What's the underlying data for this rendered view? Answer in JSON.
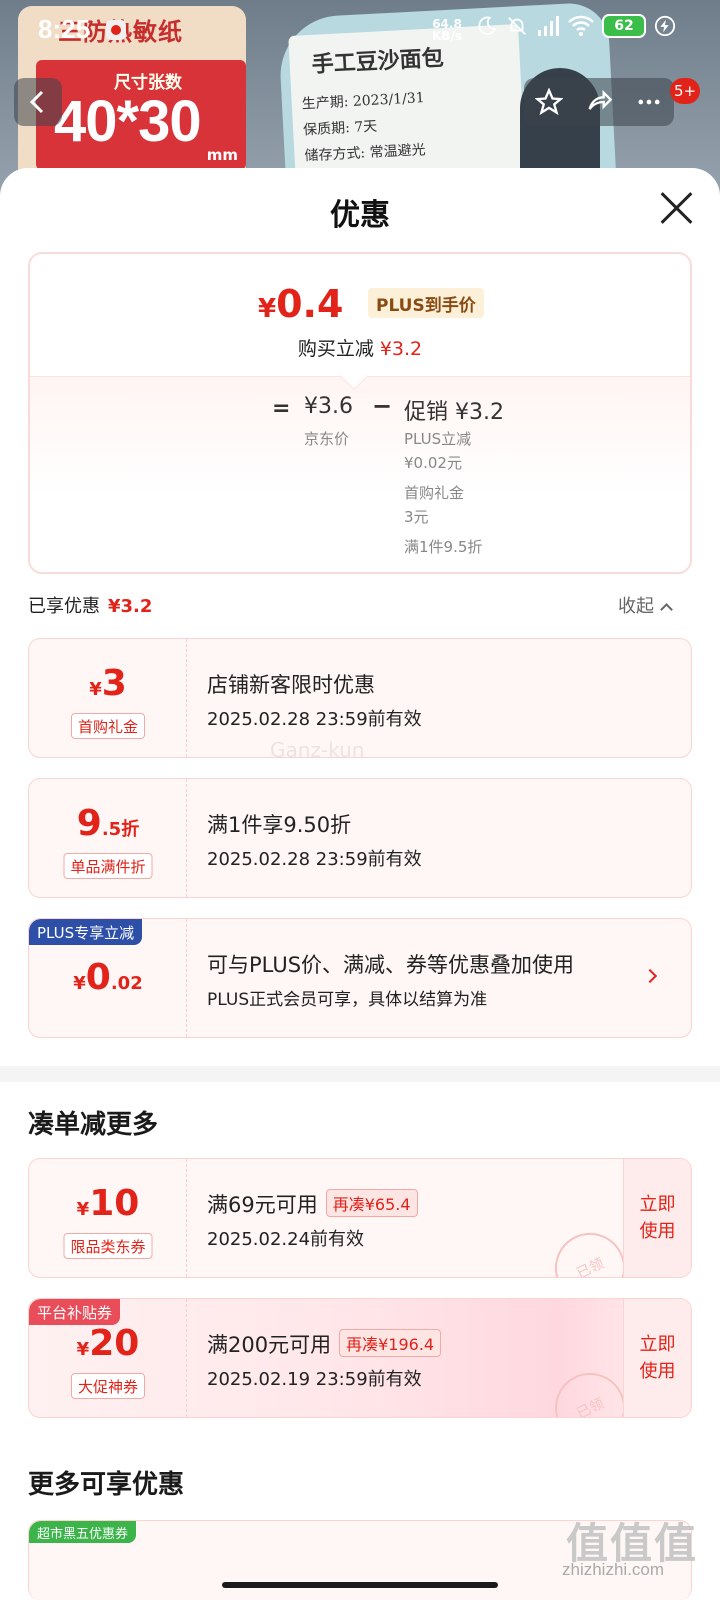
{
  "background": {
    "label_top_text": "三防热敏纸",
    "size_label": "尺寸张数",
    "size_value": "40*30",
    "size_unit": "mm",
    "roll_title": "手工豆沙面包",
    "roll_rows": [
      "生产期:  2023/1/31",
      "保质期:  7天",
      "储存方式:  常温避光"
    ],
    "badge": "5+"
  },
  "status_bar": {
    "time": "8:25",
    "net_speed": "64.8",
    "net_unit": "KB/s",
    "battery": "62"
  },
  "sheet": {
    "title": "优惠",
    "price_card": {
      "currency": "¥",
      "final_price": "0.4",
      "plus_tag": "PLUS到手价",
      "buy_reduce_label": "购买立减",
      "buy_reduce_value": "¥3.2",
      "eq": "=",
      "jd_price": "¥3.6",
      "jd_label": "京东价",
      "minus": "−",
      "promo": "促销 ¥3.2",
      "details": [
        "PLUS立减",
        "¥0.02元",
        "首购礼金",
        "3元",
        "满1件9.5折"
      ]
    },
    "enjoyed": {
      "label": "已享优惠",
      "value": "¥3.2",
      "collapse": "收起"
    },
    "watermark_text": "Ganz-kun",
    "enjoyed_coupons": [
      {
        "cur": "¥",
        "big": "3",
        "small": "",
        "tag": "首购礼金",
        "title": "店铺新客限时优惠",
        "sub": "2025.02.28 23:59前有效"
      },
      {
        "cur": "",
        "big": "9",
        "small": ".5折",
        "tag": "单品满件折",
        "title": "满1件享9.50折",
        "sub": "2025.02.28 23:59前有效"
      },
      {
        "cur": "¥",
        "big": "0",
        "small": ".02",
        "corner": "PLUS专享立减",
        "title": "可与PLUS价、满减、券等优惠叠加使用",
        "sub": "PLUS正式会员可享，具体以结算为准"
      }
    ],
    "section_more": "凑单减更多",
    "more_coupons": [
      {
        "cur": "¥",
        "big": "10",
        "tag": "限品类东券",
        "title": "满69元可用",
        "need": "再凑¥65.4",
        "sub": "2025.02.24前有效",
        "button": "立即\n使用",
        "stamp": "已领"
      },
      {
        "cur": "¥",
        "big": "20",
        "tag": "大促神券",
        "corner": "平台补贴券",
        "title": "满200元可用",
        "need": "再凑¥196.4",
        "sub": "2025.02.19 23:59前有效",
        "button": "立即\n使用",
        "stamp": "已领"
      }
    ],
    "section_extra": "更多可享优惠",
    "extra_corner": "超市黑五优惠券"
  },
  "site_watermark": "值值值",
  "site_url": "zhizhizhi.com",
  "colors": {
    "accent_red": "#e2231a",
    "plus_blue": "#2d4fa8",
    "platform_red": "#e94d5a",
    "super_green": "#3bb54a"
  }
}
